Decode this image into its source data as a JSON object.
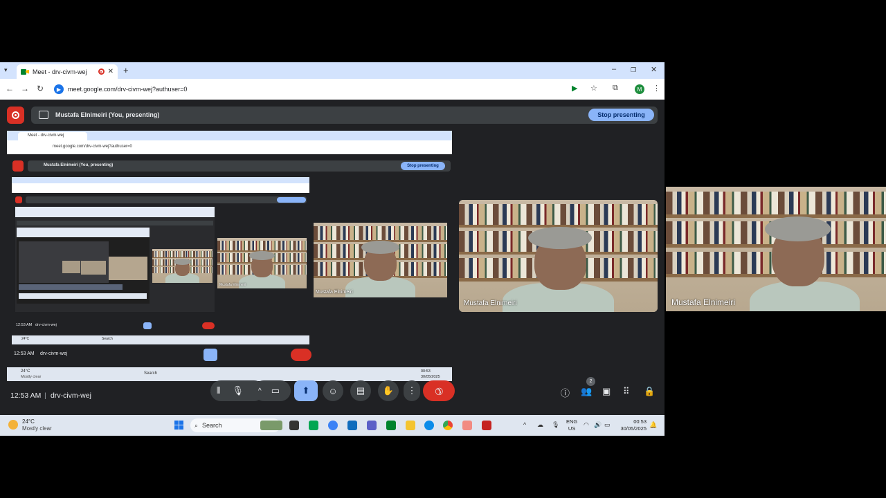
{
  "browser": {
    "tab_title": "Meet - drv-civm-wej",
    "url": "meet.google.com/drv-civm-wej?authuser=0",
    "profile_initial": "M",
    "minimize": "–",
    "maximize": "❐",
    "close": "✕",
    "new_tab": "+"
  },
  "meet": {
    "presenting_label": "Mustafa Elnimeiri (You, presenting)",
    "stop_presenting": "Stop presenting",
    "time": "12:53 AM",
    "separator": "|",
    "meeting_code": "drv-civm-wej",
    "participant_name": "Mustafa Elnimeiri",
    "participant_count": "2"
  },
  "taskbar": {
    "weather_temp": "24°C",
    "weather_desc": "Mostly clear",
    "search_placeholder": "Search",
    "lang_line1": "ENG",
    "lang_line2": "US",
    "clock_time": "00:53",
    "clock_date": "30/05/2025"
  },
  "colors": {
    "meet_bg": "#202124",
    "accent_blue": "#8ab4f8",
    "end_call_red": "#d93025",
    "tab_strip": "#d3e3fd",
    "taskbar": "#dfe6f0"
  },
  "icons": [
    "meet-icon",
    "record-icon",
    "present-icon",
    "mic-icon",
    "camera-icon",
    "present-screen-icon",
    "emoji-icon",
    "captions-icon",
    "raise-hand-icon",
    "more-icon",
    "end-call-icon",
    "info-icon",
    "people-icon",
    "chat-icon",
    "activities-icon",
    "host-controls-icon",
    "windows-start-icon",
    "search-icon",
    "weather-icon"
  ]
}
